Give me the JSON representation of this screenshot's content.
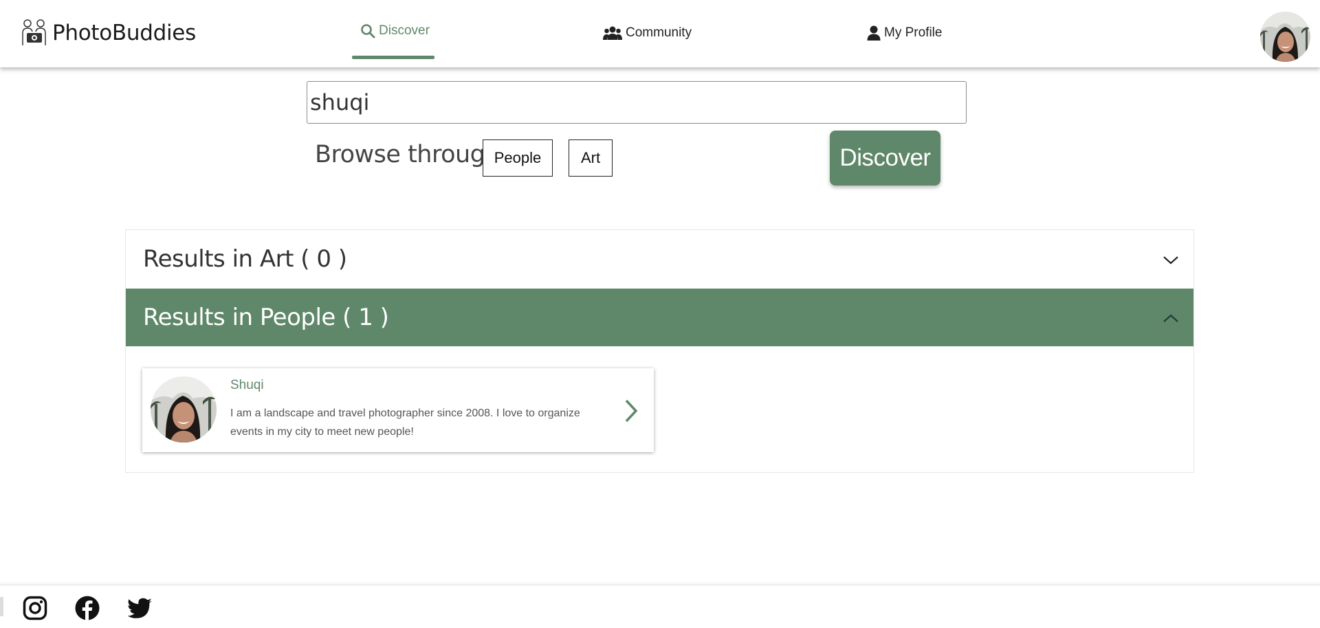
{
  "header": {
    "brand": "PhotoBuddies",
    "nav": [
      {
        "label": "Discover",
        "icon": "search-icon",
        "active": true
      },
      {
        "label": "Community",
        "icon": "users-icon",
        "active": false
      },
      {
        "label": "My Profile",
        "icon": "user-icon",
        "active": false
      }
    ]
  },
  "search": {
    "value": "shuqi",
    "browse_label": "Browse through",
    "filters": [
      "People",
      "Art"
    ],
    "submit_label": "Discover"
  },
  "results": {
    "art_title": "Results in Art ( 0 )",
    "people_title": "Results in People ( 1 )",
    "people": [
      {
        "name": "Shuqi",
        "bio": "I am a landscape and travel photographer since 2008. I love to organize events in my city to meet new people!"
      }
    ]
  },
  "footer": {
    "social": [
      "instagram-icon",
      "facebook-icon",
      "twitter-icon"
    ]
  },
  "colors": {
    "accent": "#5f8769",
    "text": "#222222",
    "border": "#8a8a8a"
  }
}
